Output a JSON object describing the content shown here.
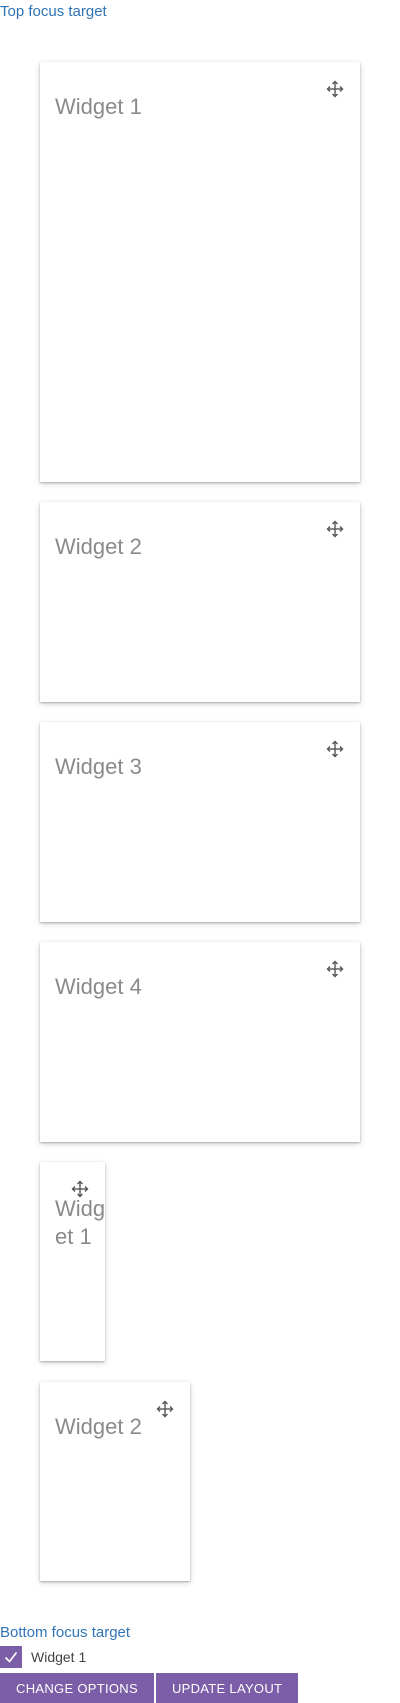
{
  "links": {
    "top_focus": "Top focus target",
    "bottom_focus": "Bottom focus target"
  },
  "widgets": [
    {
      "title": "Widget 1"
    },
    {
      "title": "Widget 2"
    },
    {
      "title": "Widget 3"
    },
    {
      "title": "Widget 4"
    },
    {
      "title": "Widget 1"
    },
    {
      "title": "Widget 2"
    }
  ],
  "icons": {
    "move": "move-icon"
  },
  "checkbox": {
    "label": "Widget 1",
    "checked": true
  },
  "buttons": {
    "change_options": "CHANGE OPTIONS",
    "update_layout": "UPDATE LAYOUT"
  },
  "colors": {
    "link": "#2f74b5",
    "accent": "#7b5ea7",
    "title": "#8a8a8a"
  }
}
